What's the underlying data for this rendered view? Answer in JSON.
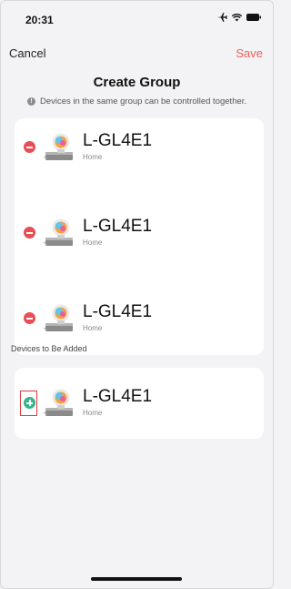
{
  "status_bar": {
    "time": "20:31",
    "icons": [
      "airplane-icon",
      "wifi-icon",
      "battery-icon"
    ]
  },
  "nav": {
    "cancel_label": "Cancel",
    "save_label": "Save",
    "save_color": "#ec5f59"
  },
  "page": {
    "title": "Create Group",
    "hint": "Devices in the same group can be controlled together."
  },
  "group_devices": [
    {
      "name": "L-GL4E1",
      "room": "Home"
    },
    {
      "name": "L-GL4E1",
      "room": "Home"
    },
    {
      "name": "L-GL4E1",
      "room": "Home"
    }
  ],
  "to_add": {
    "section_label": "Devices to Be Added",
    "devices": [
      {
        "name": "L-GL4E1",
        "room": "Home"
      }
    ]
  },
  "colors": {
    "remove": "#e84e56",
    "add": "#35b48c",
    "highlight": "#e0393e"
  }
}
